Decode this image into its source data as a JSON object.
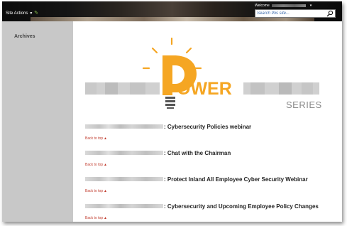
{
  "topbar": {
    "site_actions_label": "Site Actions",
    "site_actions_caret": "▼",
    "edit_icon": "✎",
    "welcome_label": "Welcome",
    "welcome_caret": "▾",
    "search_placeholder": "Search this site...",
    "search_icon": "search-icon"
  },
  "leftnav": {
    "archives_label": "Archives"
  },
  "logo": {
    "power_text": "OWER",
    "series_text": "SERIES",
    "colors": {
      "orange": "#f5a623",
      "gray": "#555555",
      "light_gray": "#d0d0d0"
    }
  },
  "items": [
    {
      "title": ": Cybersecurity Policies webinar",
      "back_to_top": "Back to top"
    },
    {
      "title": ": Chat with the Chairman",
      "back_to_top": "Back to top"
    },
    {
      "title": ": Protect Inland All Employee Cyber Security Webinar",
      "back_to_top": "Back to top"
    },
    {
      "title": ": Cybersecurity and Upcoming Employee Policy Changes",
      "back_to_top": "Back to top"
    }
  ],
  "back_to_top_icon": "▲"
}
